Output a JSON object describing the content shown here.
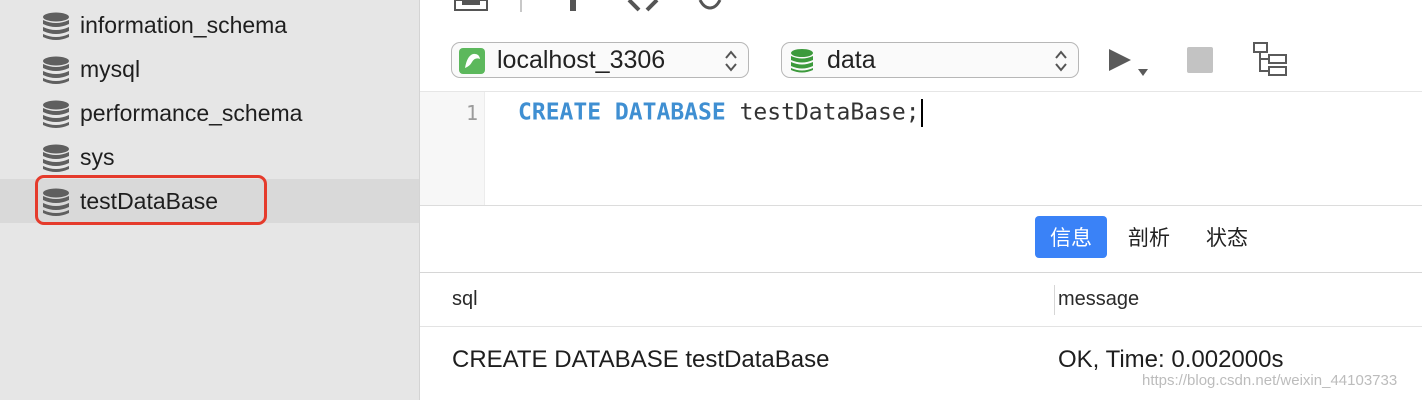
{
  "sidebar": {
    "databases": [
      {
        "label": "information_schema",
        "icon": "database-icon"
      },
      {
        "label": "mysql",
        "icon": "database-icon"
      },
      {
        "label": "performance_schema",
        "icon": "database-icon"
      },
      {
        "label": "sys",
        "icon": "database-icon"
      },
      {
        "label": "testDataBase",
        "icon": "database-icon",
        "highlighted": true
      }
    ]
  },
  "toolbar": {
    "connection": {
      "value": "localhost_3306",
      "icon": "mysql-connection-icon"
    },
    "database": {
      "value": "data",
      "icon": "database-icon"
    },
    "run_icon": "run-icon",
    "stop_icon": "stop-icon",
    "explain_icon": "explain-icon"
  },
  "editor": {
    "line_number": "1",
    "code_keyword": "CREATE DATABASE",
    "code_rest": " testDataBase;"
  },
  "results": {
    "tabs": [
      {
        "label": "信息",
        "active": true
      },
      {
        "label": "剖析",
        "active": false
      },
      {
        "label": "状态",
        "active": false
      }
    ],
    "columns": {
      "sql": "sql",
      "message": "message"
    },
    "row": {
      "sql": "CREATE DATABASE testDataBase",
      "message": "OK, Time: 0.002000s"
    }
  },
  "watermark": "https://blog.csdn.net/weixin_44103733",
  "colors": {
    "accent": "#3a82f7",
    "highlight": "#e53b2c",
    "keyword": "#3f8fd2",
    "connection_green": "#5cb85c",
    "database_green": "#3c9a3c"
  }
}
